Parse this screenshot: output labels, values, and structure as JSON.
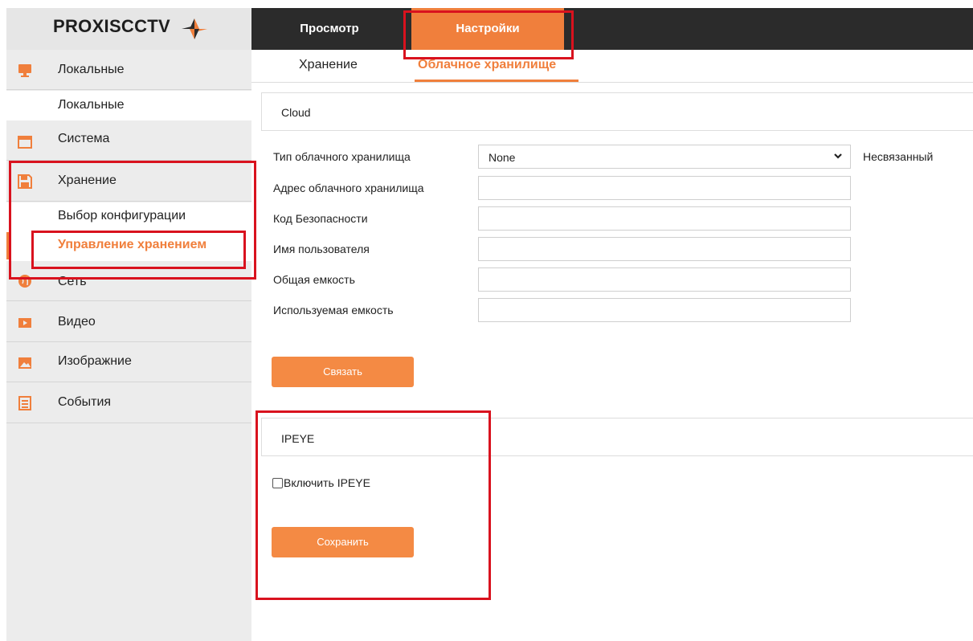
{
  "brand": {
    "name": "PROXISCCTV"
  },
  "top_nav": {
    "tabs": [
      {
        "label": "Просмотр"
      },
      {
        "label": "Настройки"
      }
    ]
  },
  "sidebar": {
    "items": [
      {
        "label": "Локальные",
        "icon": "monitor-icon"
      },
      {
        "label": "Локальные"
      },
      {
        "label": "Система",
        "icon": "window-icon"
      },
      {
        "label": "Хранение",
        "icon": "floppy-disk-icon"
      },
      {
        "label": "Выбор конфигурации"
      },
      {
        "label": "Управление хранением"
      },
      {
        "label": "Сеть",
        "icon": "globe-icon"
      },
      {
        "label": "Видео",
        "icon": "video-icon"
      },
      {
        "label": "Изображние",
        "icon": "image-icon"
      },
      {
        "label": "События",
        "icon": "list-icon"
      }
    ]
  },
  "subtabs": [
    {
      "label": "Хранение"
    },
    {
      "label": "Облачное хранилище"
    }
  ],
  "cloud": {
    "title": "Cloud",
    "fields": [
      {
        "label": "Тип облачного хранилища",
        "value": "None",
        "status": "Несвязанный"
      },
      {
        "label": "Адрес облачного хранилища",
        "value": ""
      },
      {
        "label": "Код Безопасности",
        "value": ""
      },
      {
        "label": "Имя пользователя",
        "value": ""
      },
      {
        "label": "Общая емкость",
        "value": ""
      },
      {
        "label": "Используемая емкость",
        "value": ""
      }
    ],
    "link_button": "Связать"
  },
  "ipeye": {
    "title": "IPEYE",
    "enable_label": "Включить IPEYE",
    "enabled": false,
    "save_button": "Сохранить"
  },
  "colors": {
    "accent": "#f07f3c",
    "nav_bg": "#2b2b2b",
    "highlight": "#d9121e"
  }
}
